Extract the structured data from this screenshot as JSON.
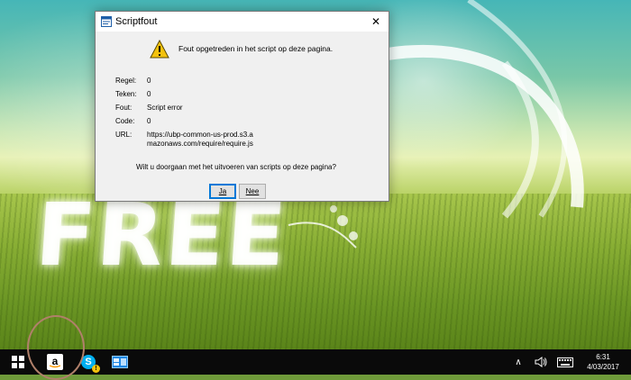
{
  "dialog": {
    "title": "Scriptfout",
    "close_label": "✕",
    "message": "Fout opgetreden in het script op deze pagina.",
    "details": [
      {
        "key": "Regel:",
        "value": "0"
      },
      {
        "key": "Teken:",
        "value": "0"
      },
      {
        "key": "Fout:",
        "value": "Script error"
      },
      {
        "key": "Code:",
        "value": "0"
      },
      {
        "key": "URL:",
        "value": "https://ubp-common-us-prod.s3.amazonaws.com/require/require.js"
      }
    ],
    "question": "Wilt u doorgaan met het uitvoeren van scripts op deze pagina?",
    "yes_label": "Ja",
    "no_label": "Nee"
  },
  "wallpaper": {
    "text": "FREE"
  },
  "taskbar": {
    "amazon_glyph": "a",
    "skype_glyph": "S",
    "skype_badge": "!",
    "tray_up_glyph": "∧",
    "clock_time": "6:31",
    "clock_date": "4/03/2017"
  },
  "colors": {
    "accent": "#0078d7",
    "warning": "#f4c20d",
    "taskbar": "#0a0a0a",
    "highlight_circle": "#b0806a"
  },
  "icons": [
    "windows-start-icon",
    "amazon-icon",
    "skype-icon",
    "app-icon",
    "warning-icon",
    "volume-icon",
    "keyboard-icon"
  ]
}
